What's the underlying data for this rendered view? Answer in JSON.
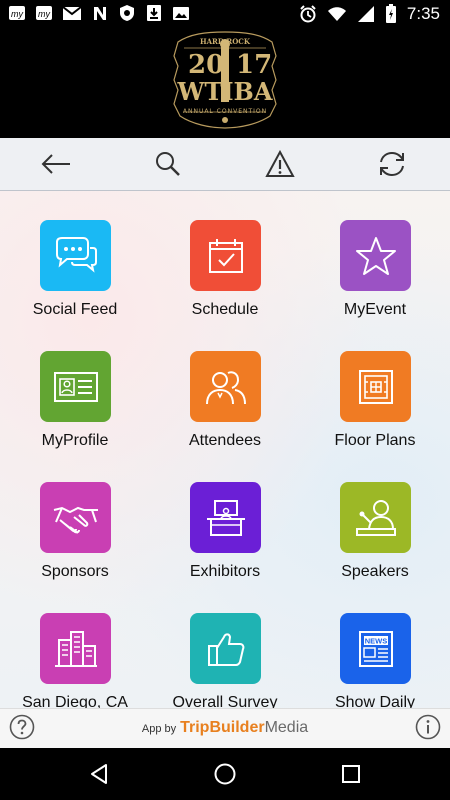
{
  "status_bar": {
    "time": "7:35",
    "left_icons": [
      "my-app-icon",
      "my-app-icon",
      "gmail-icon",
      "nyt-icon",
      "shield-icon",
      "download-icon",
      "photo-icon"
    ],
    "right_icons": [
      "alarm-icon",
      "wifi-icon",
      "signal-icon",
      "battery-icon"
    ]
  },
  "header": {
    "logo_text": {
      "top": "HARD ROCK",
      "year_left": "20",
      "year_right": "17",
      "main": "WTIBA",
      "sub": "ANNUAL CONVENTION"
    }
  },
  "toolbar": {
    "icons": [
      "back-arrow-icon",
      "search-icon",
      "warning-icon",
      "refresh-icon"
    ]
  },
  "tiles": [
    {
      "label": "Social Feed",
      "color": "#1ab9f4",
      "icon": "chat-bubbles-icon"
    },
    {
      "label": "Schedule",
      "color": "#f04e37",
      "icon": "calendar-check-icon"
    },
    {
      "label": "MyEvent",
      "color": "#9b52c4",
      "icon": "star-icon"
    },
    {
      "label": "MyProfile",
      "color": "#62a532",
      "icon": "id-card-icon"
    },
    {
      "label": "Attendees",
      "color": "#f07b23",
      "icon": "people-icon"
    },
    {
      "label": "Floor Plans",
      "color": "#f07b23",
      "icon": "floor-plan-icon"
    },
    {
      "label": "Sponsors",
      "color": "#c93fb3",
      "icon": "handshake-icon"
    },
    {
      "label": "Exhibitors",
      "color": "#6b1fd6",
      "icon": "booth-icon"
    },
    {
      "label": "Speakers",
      "color": "#9cb826",
      "icon": "speaker-icon"
    },
    {
      "label": "San Diego, CA",
      "color": "#c93fb3",
      "icon": "city-icon"
    },
    {
      "label": "Overall Survey",
      "color": "#1fb3b3",
      "icon": "thumbs-up-icon"
    },
    {
      "label": "Show Daily",
      "color": "#1a63ea",
      "icon": "newspaper-icon"
    }
  ],
  "footer": {
    "app_by": "App by",
    "brand_bold": "TripBuilder",
    "brand_light": "Media"
  },
  "navbar": {
    "icons": [
      "back-triangle-icon",
      "home-circle-icon",
      "recents-square-icon"
    ]
  }
}
